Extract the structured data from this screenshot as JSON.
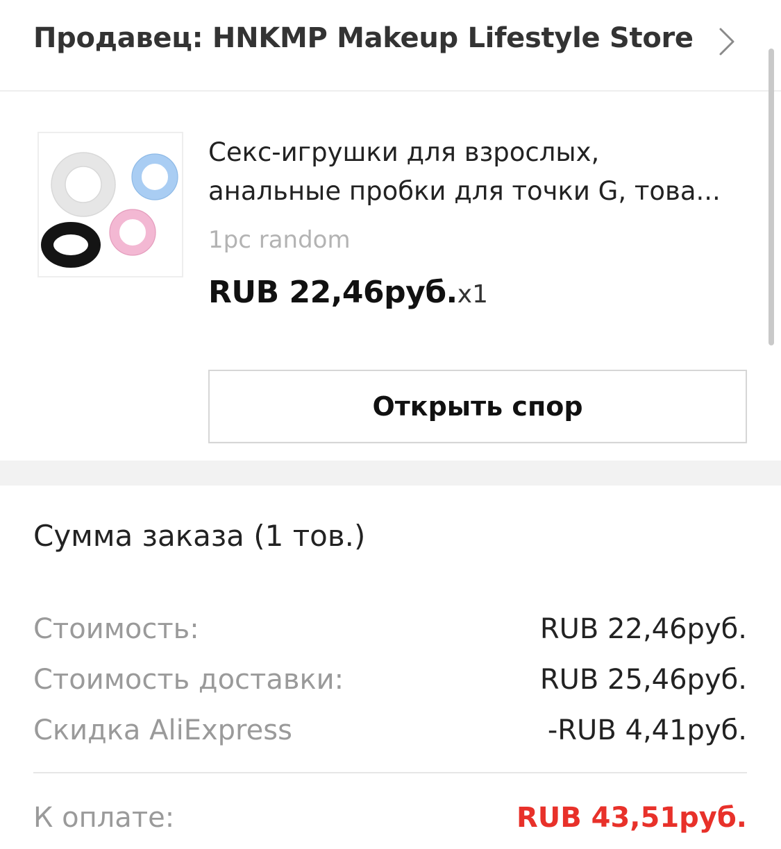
{
  "seller": {
    "title": "Продавец: HNKMP Makeup Lifestyle Store",
    "chevron_icon": "chevron-right-icon"
  },
  "product": {
    "title_line1": "Секс-игрушки для взрослых,",
    "title_line2": "анальные пробки для точки G, това...",
    "variant": "1pc random",
    "price": "RUB 22,46руб.",
    "quantity": "x1",
    "thumbnail_icon": "product-rings-image",
    "thumbnail_colors": [
      "#f1f1f1",
      "#a9cdf3",
      "#1a1a1a",
      "#f3b8d3"
    ]
  },
  "actions": {
    "open_dispute": "Открыть спор"
  },
  "summary": {
    "title": "Сумма заказа (1 тов.)",
    "rows": [
      {
        "label": "Стоимость:",
        "value": "RUB 22,46руб."
      },
      {
        "label": "Стоимость доставки:",
        "value": "RUB 25,46руб."
      },
      {
        "label": "Скидка AliExpress",
        "value": "-RUB 4,41руб."
      }
    ],
    "total_label": "К оплате:",
    "total_value": "RUB 43,51руб.",
    "total_color": "#e8312a"
  }
}
